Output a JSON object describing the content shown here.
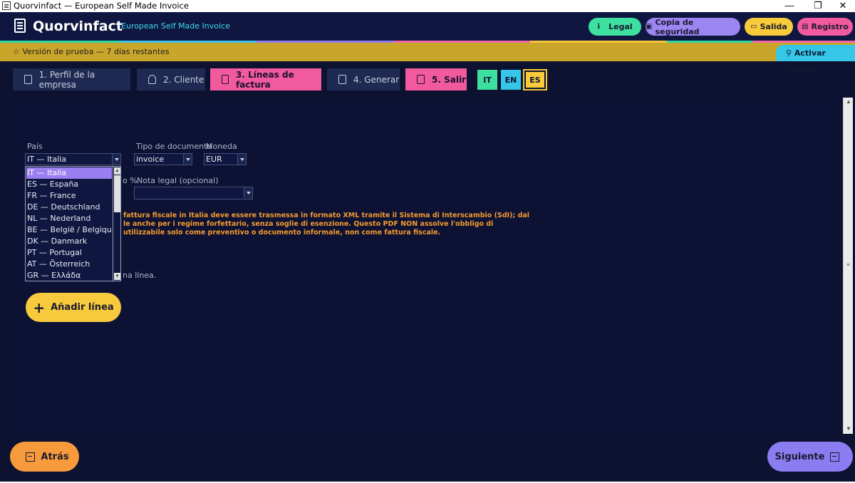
{
  "window": {
    "title": "Quorvinfact — European Self Made Invoice",
    "minimize": "—",
    "restore": "❐",
    "close": "✕"
  },
  "header": {
    "brand": "Quorvinfact",
    "subtitle": "European Self Made Invoice",
    "buttons": [
      {
        "label": "Legal",
        "icon": "info-icon",
        "color": "#3ee0a0"
      },
      {
        "label": "Copia de seguridad",
        "icon": "save-icon",
        "color": "#9b86f2"
      },
      {
        "label": "Salida",
        "icon": "folder-icon",
        "color": "#f7cb3a"
      },
      {
        "label": "Registro",
        "icon": "log-icon",
        "color": "#f25aa0"
      }
    ]
  },
  "trial": {
    "text": "Versión de prueba — 7 días restantes",
    "license_button": "Activar licencia"
  },
  "tabs": [
    {
      "label": "1. Perfil de la empresa",
      "icon": "building-icon",
      "active": false
    },
    {
      "label": "2. Cliente",
      "icon": "user-icon",
      "active": false
    },
    {
      "label": "3. Líneas de factura",
      "icon": "list-icon",
      "active": true
    },
    {
      "label": "4. Generar",
      "icon": "document-icon",
      "active": false
    },
    {
      "label": "5. Salir",
      "icon": "exit-icon",
      "active": true
    }
  ],
  "languages": [
    {
      "code": "IT",
      "color": "#3ee0a0",
      "selected": false
    },
    {
      "code": "EN",
      "color": "#35c6e8",
      "selected": false
    },
    {
      "code": "ES",
      "color": "#f7cb3a",
      "selected": true
    }
  ],
  "form": {
    "country_label": "País",
    "country_value": "IT — Italia",
    "doctype_label": "Tipo de documento",
    "doctype_value": "invoice",
    "currency_label": "Moneda",
    "currency_value": "EUR",
    "vat_label_fragment": "o %",
    "legal_note_label": "Nota legal (opcional)",
    "legal_note_value": "",
    "warning_lines": [
      "fattura fiscale in Italia deve essere trasmessa in formato XML tramite il Sistema di Interscambio (SdI); dal",
      "le anche per i regime forfettario, senza soglie di esenzione. Questo PDF NON assolve l'obbligo di",
      "utilizzabile solo come preventivo o documento informale, non come fattura fiscale."
    ],
    "lines_hint_fragment": "na línea.",
    "add_line_button": "Añadir línea"
  },
  "country_options": [
    "IT — Italia",
    "ES — España",
    "FR — France",
    "DE — Deutschland",
    "NL — Nederland",
    "BE — België / Belgique",
    "DK — Danmark",
    "PT — Portugal",
    "AT — Österreich",
    "GR — Ελλάδα"
  ],
  "footer": {
    "back_button": "Atrás",
    "next_button": "Siguiente"
  },
  "colors": {
    "background": "#0c1230",
    "accent_pink": "#f25aa0",
    "warning_text": "#f39a2e",
    "add_button": "#f7c93c",
    "back_button": "#f79a3c",
    "next_button": "#8b7cf2"
  }
}
